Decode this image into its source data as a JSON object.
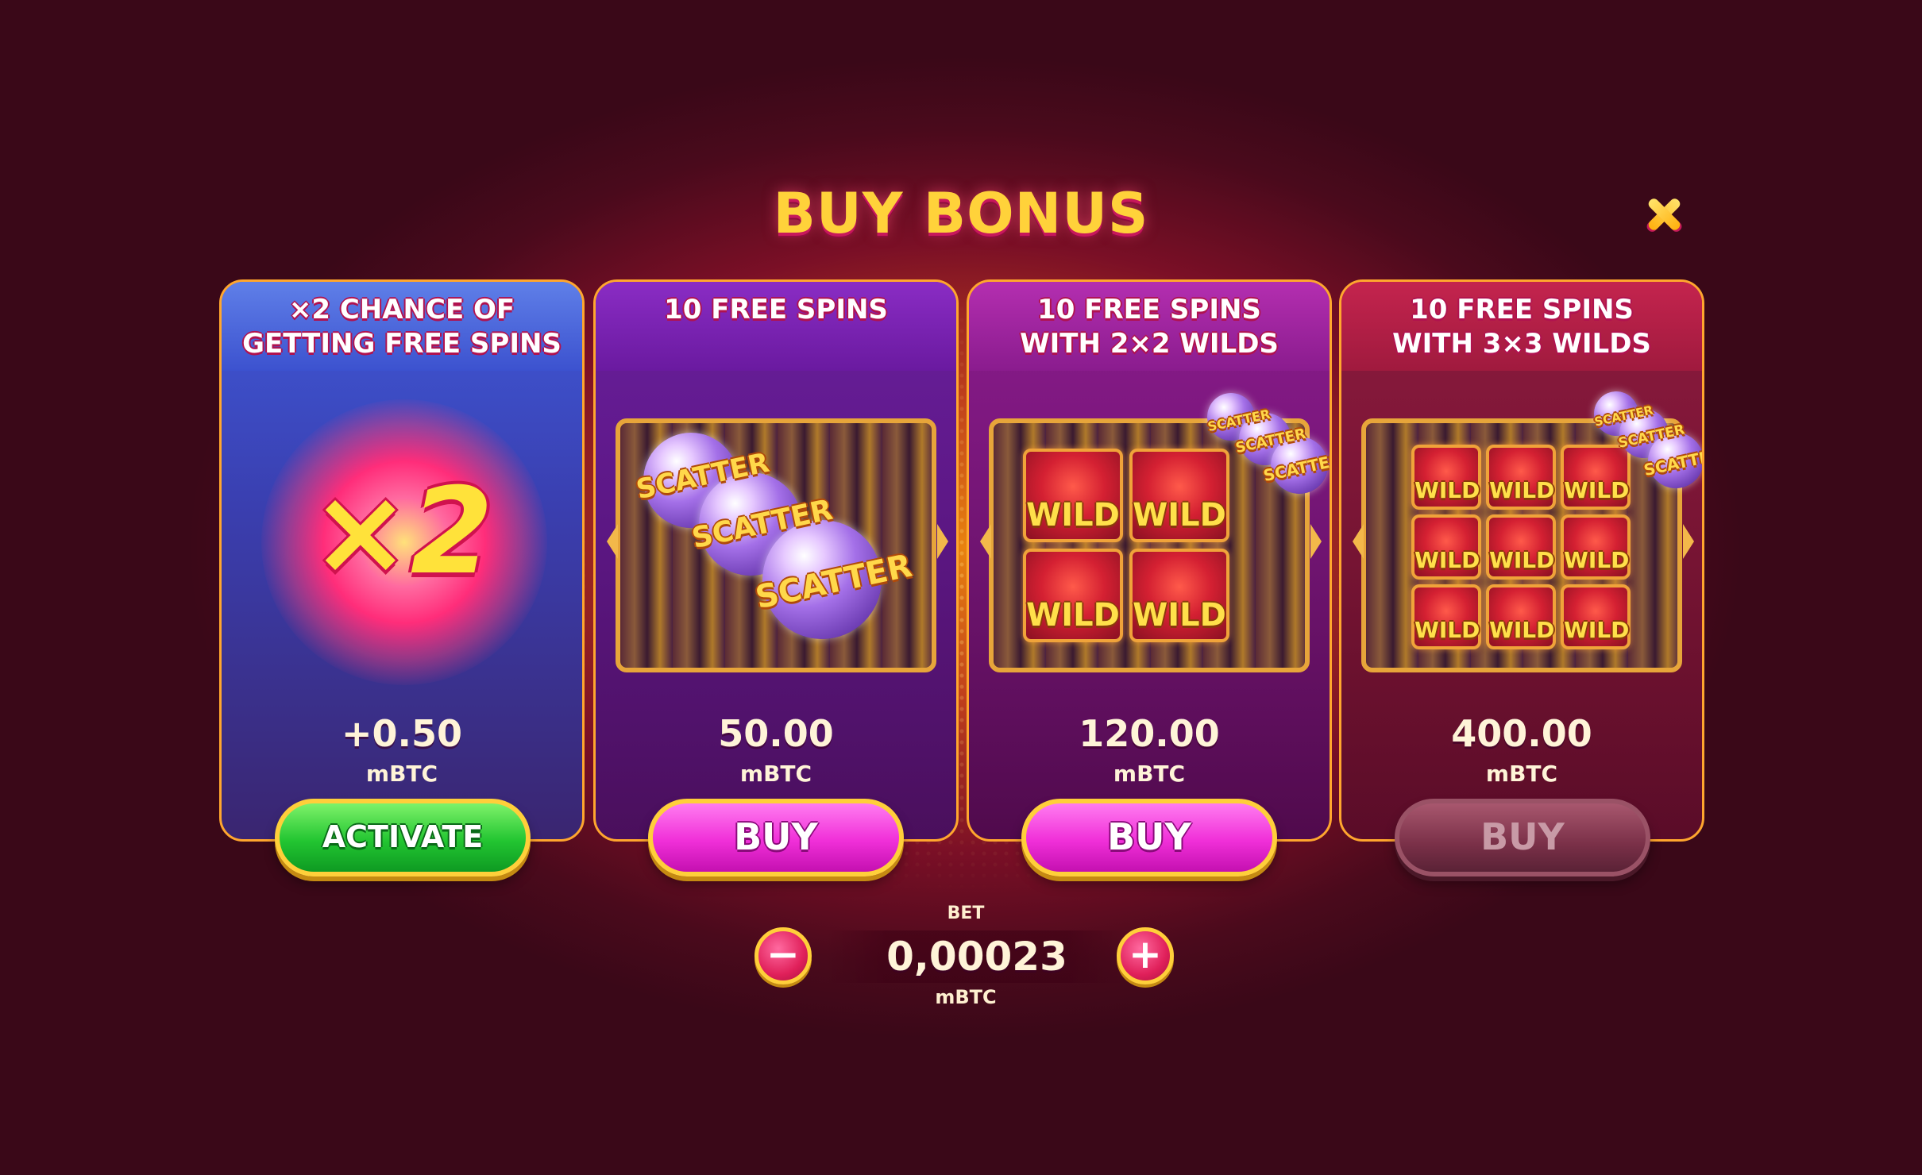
{
  "title": "BUY BONUS",
  "close_icon": "close-icon",
  "cards": [
    {
      "heading_line1": "×2 CHANCE OF",
      "heading_line2": "GETTING FREE SPINS",
      "art_text": "×2",
      "price": "+0.50",
      "unit": "mBTC",
      "button": "ACTIVATE",
      "button_state": "enabled"
    },
    {
      "heading_line1": "10 FREE SPINS",
      "heading_line2": "",
      "price": "50.00",
      "unit": "mBTC",
      "button": "BUY",
      "button_state": "enabled"
    },
    {
      "heading_line1": "10 FREE SPINS",
      "heading_line2": "WITH 2×2 WILDS",
      "price": "120.00",
      "unit": "mBTC",
      "button": "BUY",
      "button_state": "enabled"
    },
    {
      "heading_line1": "10 FREE SPINS",
      "heading_line2": "WITH 3×3 WILDS",
      "price": "400.00",
      "unit": "mBTC",
      "button": "BUY",
      "button_state": "disabled"
    }
  ],
  "symbols": {
    "scatter": "SCATTER",
    "wild": "WILD"
  },
  "bet": {
    "label": "BET",
    "value": "0,00023",
    "unit": "mBTC",
    "minus": "−",
    "plus": "+"
  },
  "colors": {
    "title": "#ffd23a",
    "card_border": "#ffa62e",
    "activate": "#22c531",
    "buy": "#f02fd8",
    "buy_disabled": "#7a3048"
  }
}
